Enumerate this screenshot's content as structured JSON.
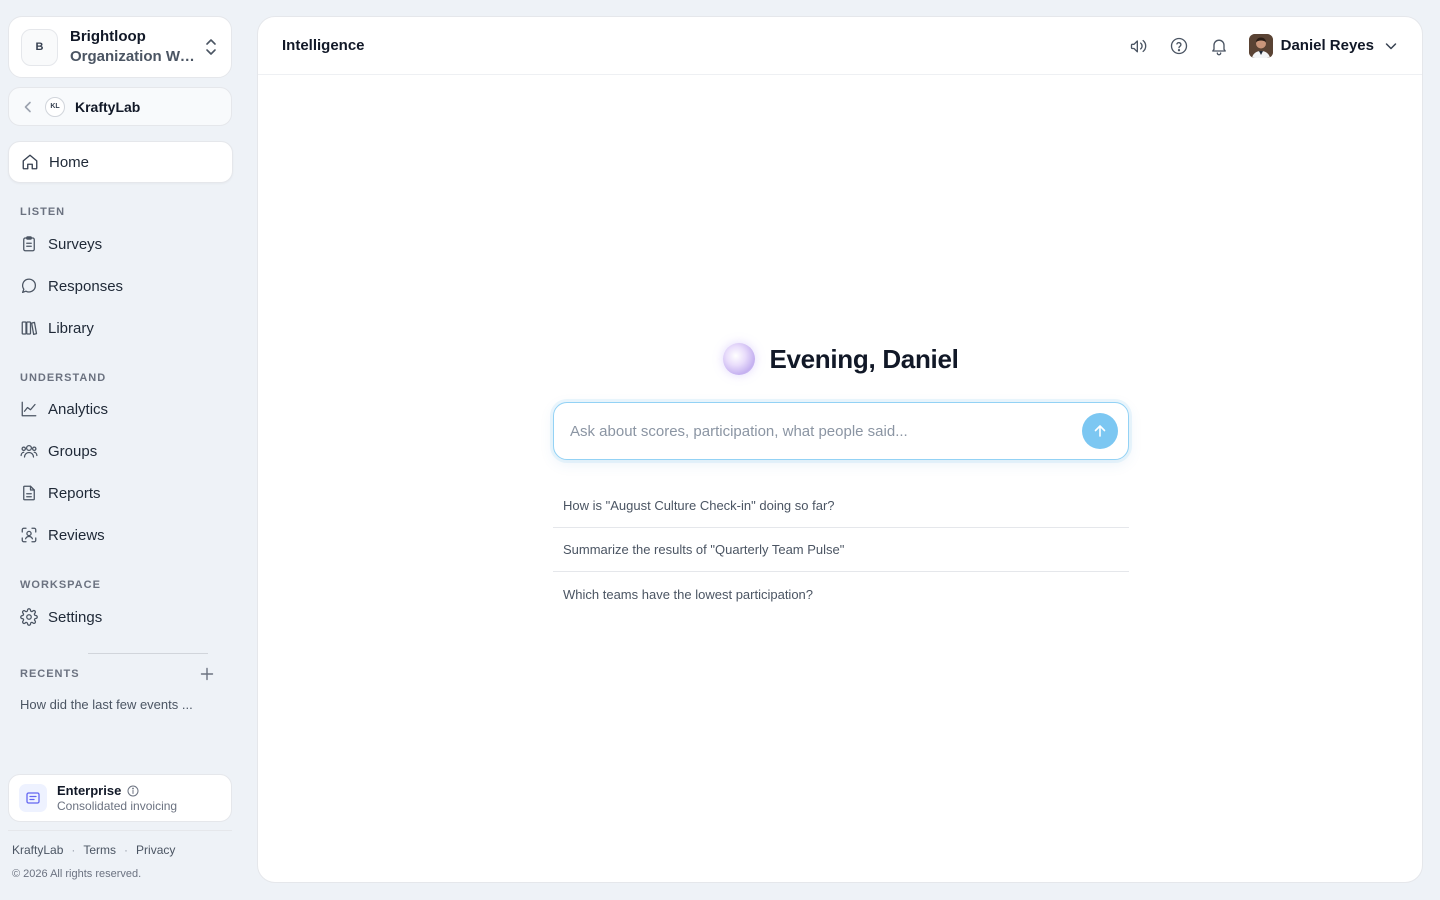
{
  "workspace": {
    "initial": "B",
    "name": "Brightloop",
    "subtitle": "Organization Wor..."
  },
  "org": {
    "logo": "KL",
    "name": "KraftyLab"
  },
  "nav": {
    "home": "Home",
    "sections": [
      {
        "label": "LISTEN",
        "items": [
          "Surveys",
          "Responses",
          "Library"
        ]
      },
      {
        "label": "UNDERSTAND",
        "items": [
          "Analytics",
          "Groups",
          "Reports",
          "Reviews"
        ]
      },
      {
        "label": "WORKSPACE",
        "items": [
          "Settings"
        ]
      }
    ]
  },
  "recents": {
    "label": "RECENTS",
    "items": [
      "How did the last few events ..."
    ]
  },
  "plan": {
    "name": "Enterprise",
    "subtitle": "Consolidated invoicing"
  },
  "footer": {
    "links": [
      "KraftyLab",
      "Terms",
      "Privacy"
    ],
    "copyright": "© 2026 All rights reserved."
  },
  "header": {
    "title": "Intelligence",
    "user_name": "Daniel Reyes"
  },
  "greeting": "Evening, Daniel",
  "ask": {
    "placeholder": "Ask about scores, participation, what people said..."
  },
  "suggestions": [
    "How is \"August Culture Check-in\" doing so far?",
    "Summarize the results of \"Quarterly Team Pulse\"",
    "Which teams have the lowest participation?"
  ],
  "colors": {
    "accent": "#7cc7f2",
    "border_focus": "#93d2f5",
    "background": "#eef2f7"
  }
}
